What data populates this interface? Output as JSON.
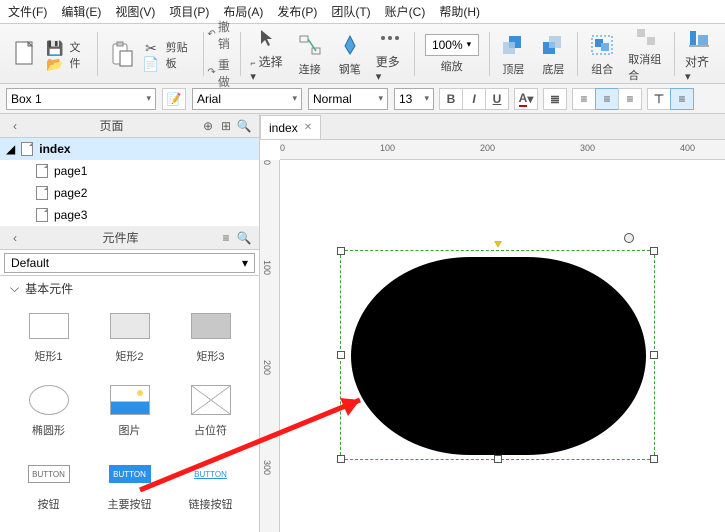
{
  "menu": {
    "file": "文件(F)",
    "edit": "编辑(E)",
    "view": "视图(V)",
    "project": "项目(P)",
    "layout": "布局(A)",
    "publish": "发布(P)",
    "team": "团队(T)",
    "account": "账户(C)",
    "help": "帮助(H)"
  },
  "tb": {
    "file": "文件",
    "clipboard": "剪贴板",
    "undo": "撤销",
    "redo": "重做",
    "select": "选择",
    "connect": "连接",
    "pen": "钢笔",
    "more": "更多",
    "zoom": "缩放",
    "zoomval": "100%",
    "front": "顶层",
    "back": "底层",
    "group": "组合",
    "ungroup": "取消组合",
    "align": "对齐"
  },
  "fmt": {
    "name": "Box 1",
    "font": "Arial",
    "weight": "Normal",
    "size": "13"
  },
  "pages": {
    "title": "页面",
    "root": "index",
    "items": [
      "page1",
      "page2",
      "page3"
    ]
  },
  "lib": {
    "title": "元件库",
    "preset": "Default",
    "section": "基本元件",
    "items": [
      {
        "label": "矩形1"
      },
      {
        "label": "矩形2"
      },
      {
        "label": "矩形3"
      },
      {
        "label": "椭圆形"
      },
      {
        "label": "图片"
      },
      {
        "label": "占位符"
      },
      {
        "label": "按钮",
        "tag": "BUTTON"
      },
      {
        "label": "主要按钮",
        "tag": "BUTTON"
      },
      {
        "label": "链接按钮",
        "tag": "BUTTON"
      }
    ]
  },
  "canvas": {
    "tab": "index",
    "hticks": [
      "0",
      "100",
      "200",
      "300",
      "400"
    ],
    "vticks": [
      "0",
      "100",
      "200",
      "300"
    ]
  }
}
